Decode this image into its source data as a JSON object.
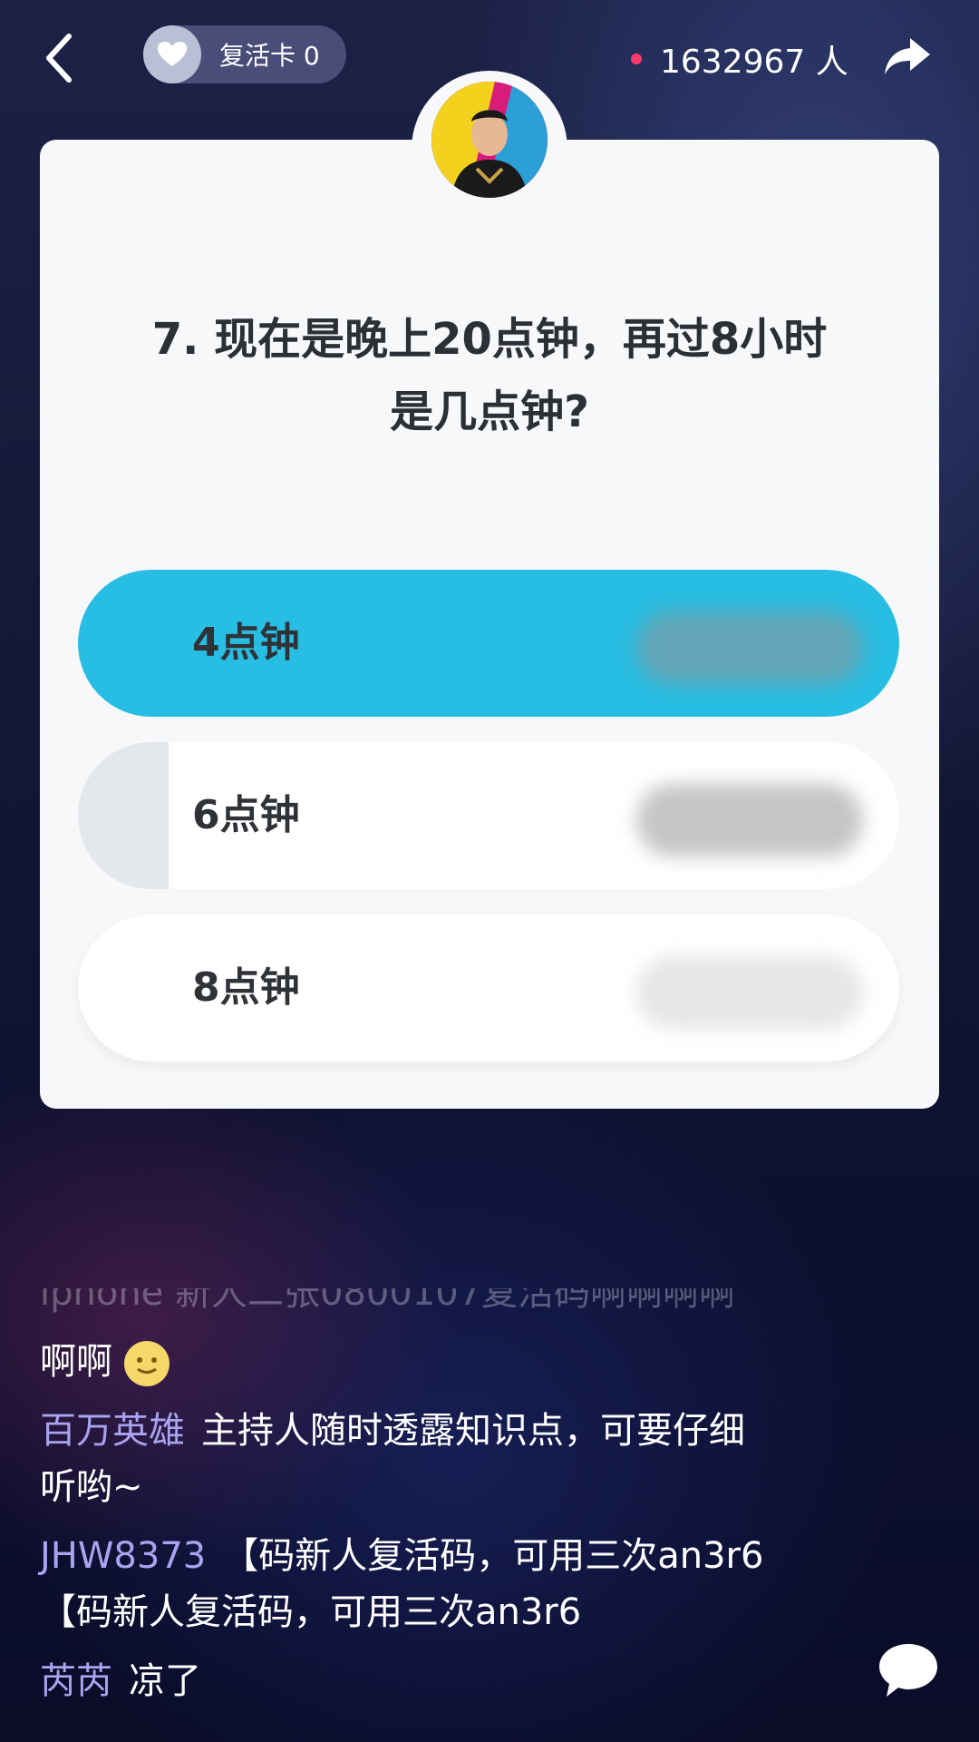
{
  "header": {
    "revive_card": "复活卡 0",
    "viewer_count": "1632967 人"
  },
  "question": {
    "line1": "7. 现在是晚上20点钟，再过8小时",
    "line2": "是几点钟?",
    "options": [
      {
        "label": "4点钟",
        "selected": true
      },
      {
        "label": "6点钟",
        "selected": false
      },
      {
        "label": "8点钟",
        "selected": false
      }
    ]
  },
  "chat": {
    "faded_line": "iphone  新人二张0800107复活码啊啊啊啊",
    "messages": [
      {
        "user": "",
        "text": "啊啊"
      },
      {
        "user": "百万英雄",
        "text": "主持人随时透露知识点，可要仔细",
        "text2": "听哟~"
      },
      {
        "user": "JHW8373",
        "text": "【码新人复活码，可用三次an3r6",
        "text2": "【码新人复活码，可用三次an3r6"
      },
      {
        "user": "芮芮",
        "text": "凉了"
      }
    ]
  },
  "colors": {
    "selected_option": "#28bde2",
    "card_bg": "#f7f8fa",
    "username": "#a9a3f0",
    "live_dot": "#ff3b6b"
  },
  "icons": [
    "back-arrow-icon",
    "heart-icon",
    "share-arrow-icon",
    "chat-bubble-icon",
    "smile-emoji-icon"
  ]
}
